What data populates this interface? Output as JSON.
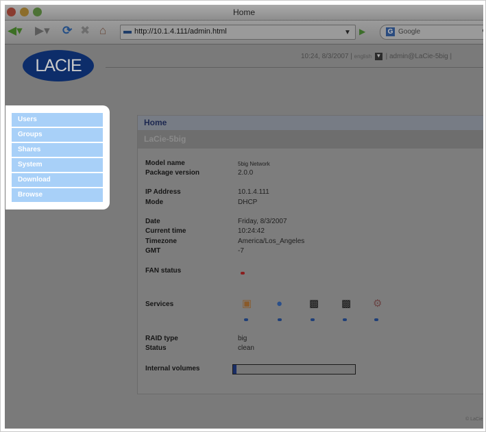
{
  "window": {
    "title": "Home",
    "url": "http://10.1.4.111/admin.html",
    "search_placeholder": "Google"
  },
  "header": {
    "logo_text": "LACIE",
    "timestamp": "10:24, 8/3/2007 |",
    "language": "english",
    "user": "| admin@LaCie-5big |"
  },
  "sidebar": {
    "items": [
      {
        "label": "Users"
      },
      {
        "label": "Groups"
      },
      {
        "label": "Shares"
      },
      {
        "label": "System"
      },
      {
        "label": "Download"
      },
      {
        "label": "Browse"
      }
    ]
  },
  "panel": {
    "title": "Home",
    "subtitle": "LaCie-5big",
    "info": {
      "model_name_label": "Model name",
      "model_name": "5big Network",
      "package_version_label": "Package version",
      "package_version": "2.0.0",
      "ip_label": "IP Address",
      "ip": "10.1.4.111",
      "mode_label": "Mode",
      "mode": "DHCP",
      "date_label": "Date",
      "date": "Friday, 8/3/2007",
      "time_label": "Current time",
      "time": "10:24:42",
      "timezone_label": "Timezone",
      "timezone": "America/Los_Angeles",
      "gmt_label": "GMT",
      "gmt": "-7",
      "fan_label": "FAN status",
      "services_label": "Services",
      "raid_label": "RAID type",
      "raid": "big",
      "status_label": "Status",
      "status": "clean",
      "volumes_label": "Internal volumes"
    },
    "services": [
      {
        "icon": "windows-icon"
      },
      {
        "icon": "apple-icon"
      },
      {
        "icon": "ftp-icon"
      },
      {
        "icon": "http-icon"
      },
      {
        "icon": "upnp-icon"
      }
    ],
    "internal_volumes_fill": 0.03
  },
  "footer": {
    "copyright": "© LaCie"
  }
}
